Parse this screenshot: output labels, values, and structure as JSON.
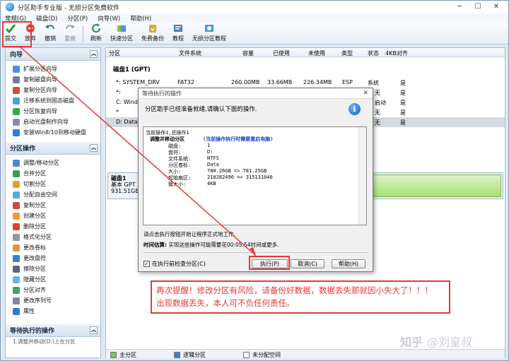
{
  "window": {
    "title": "分区助手专业版 - 无损分区免费软件"
  },
  "menu": [
    "常规(G)",
    "磁盘(D)",
    "分区(P)",
    "向导(W)",
    "帮助(H)"
  ],
  "toolbar": {
    "items": [
      {
        "label": "提交",
        "icon": "check-icon"
      },
      {
        "label": "放弃",
        "icon": "discard-icon"
      },
      {
        "label": "撤销",
        "icon": "undo-icon"
      },
      {
        "label": "重做",
        "icon": "redo-icon"
      },
      {
        "label": "刷新",
        "icon": "refresh-icon"
      },
      {
        "label": "快速分区",
        "icon": "quick-partition-icon"
      },
      {
        "label": "免费备份",
        "icon": "backup-icon"
      },
      {
        "label": "教程",
        "icon": "tutorial-icon"
      },
      {
        "label": "无损分区教程",
        "icon": "lossless-tutorial-icon"
      }
    ]
  },
  "wizard": {
    "title": "向导",
    "items": [
      "扩展分区向导",
      "复制磁盘向导",
      "复制分区向导",
      "迁移系统到固态磁盘",
      "分区恢复向导",
      "启动光盘制作向导",
      "安装Win8/10到移动硬盘"
    ]
  },
  "partops": {
    "title": "分区操作",
    "items": [
      "调整/移动分区",
      "合并分区",
      "切割分区",
      "分配自由空间",
      "复制分区",
      "创建分区",
      "删除分区",
      "格式化分区",
      "更改卷标",
      "更改盘符",
      "擦除分区",
      "隐藏分区",
      "分区对齐",
      "更改序列号",
      "属性"
    ]
  },
  "pending": {
    "title": "等待执行的操作",
    "item": "1.调整并移动(D:)上在分区"
  },
  "table": {
    "headers": [
      "分区",
      "文件系统",
      "容量",
      "已使用",
      "未使用",
      "类型",
      "状态",
      "4KB对齐"
    ],
    "disk_label": "磁盘1 (GPT)",
    "rows": [
      {
        "name": "*: SYSTEM_DRV",
        "fs": "FAT32",
        "cap": "260.00MB",
        "used": "33.66MB",
        "free": "226.34MB",
        "type": "ESP",
        "status": "系统",
        "align": "是"
      },
      {
        "name": "*:",
        "fs": "",
        "cap": "",
        "used": "",
        "free": "",
        "type": "",
        "status": "无",
        "align": "是"
      },
      {
        "name": "C: Window",
        "fs": "",
        "cap": "",
        "used": "",
        "free": "",
        "type": "",
        "status": "启动",
        "align": "是"
      },
      {
        "name": "*",
        "fs": "",
        "cap": "",
        "used": "",
        "free": "",
        "type": "",
        "status": "无",
        "align": "是"
      },
      {
        "name": "D: Data",
        "fs": "",
        "cap": "",
        "used": "",
        "free": "",
        "type": "",
        "status": "无",
        "align": "是"
      }
    ]
  },
  "diskmap": {
    "name": "磁盘1",
    "type": "基本 GPT",
    "size": "931.51GB"
  },
  "legend": [
    "主分区",
    "逻辑分区",
    "未分配空间"
  ],
  "dialog": {
    "title": "等待执行的操作",
    "message": "分区助手已经准备就绪,请确认下面的操作.",
    "list": {
      "header": "当前操作1,总操作1",
      "op_title": "调整并移动分区",
      "op_note": "(当前操作执行时需要重启电脑)",
      "fields": [
        {
          "k": "磁盘:",
          "v": "1"
        },
        {
          "k": "盘符:",
          "v": "D:"
        },
        {
          "k": "文件系统:",
          "v": "NTFS"
        },
        {
          "k": "分区卷标:",
          "v": "Data"
        },
        {
          "k": "大小:",
          "v": "780.26GB => 781.25GB"
        },
        {
          "k": "起始扇区:",
          "v": "210282496 => 315131040"
        },
        {
          "k": "簇大小:",
          "v": "4KB"
        }
      ]
    },
    "note1": "请点击执行按钮开始让程序正式地工作.",
    "note2_label": "时间估算:",
    "note2_text": "实现这些操作可能需要花00:05:54时间或更多.",
    "checkbox": "在执行前检查分区(C)",
    "btn_execute": "执行(P)",
    "btn_cancel": "取消(C)",
    "btn_help": "帮助(H)"
  },
  "warning": {
    "line1": "再次提醒！修改分区有风险，请备份好数据，数据丢失那就因小失大了！！！",
    "line2": "出现数据丢失，本人可不负任何责任。"
  },
  "watermark": {
    "brand": "知乎",
    "handle": "@刘皇叔"
  },
  "colors": {
    "annotation_red": "#e53935",
    "disk_bar_green": "#a6df77",
    "title_accent": "#1b2a40"
  }
}
